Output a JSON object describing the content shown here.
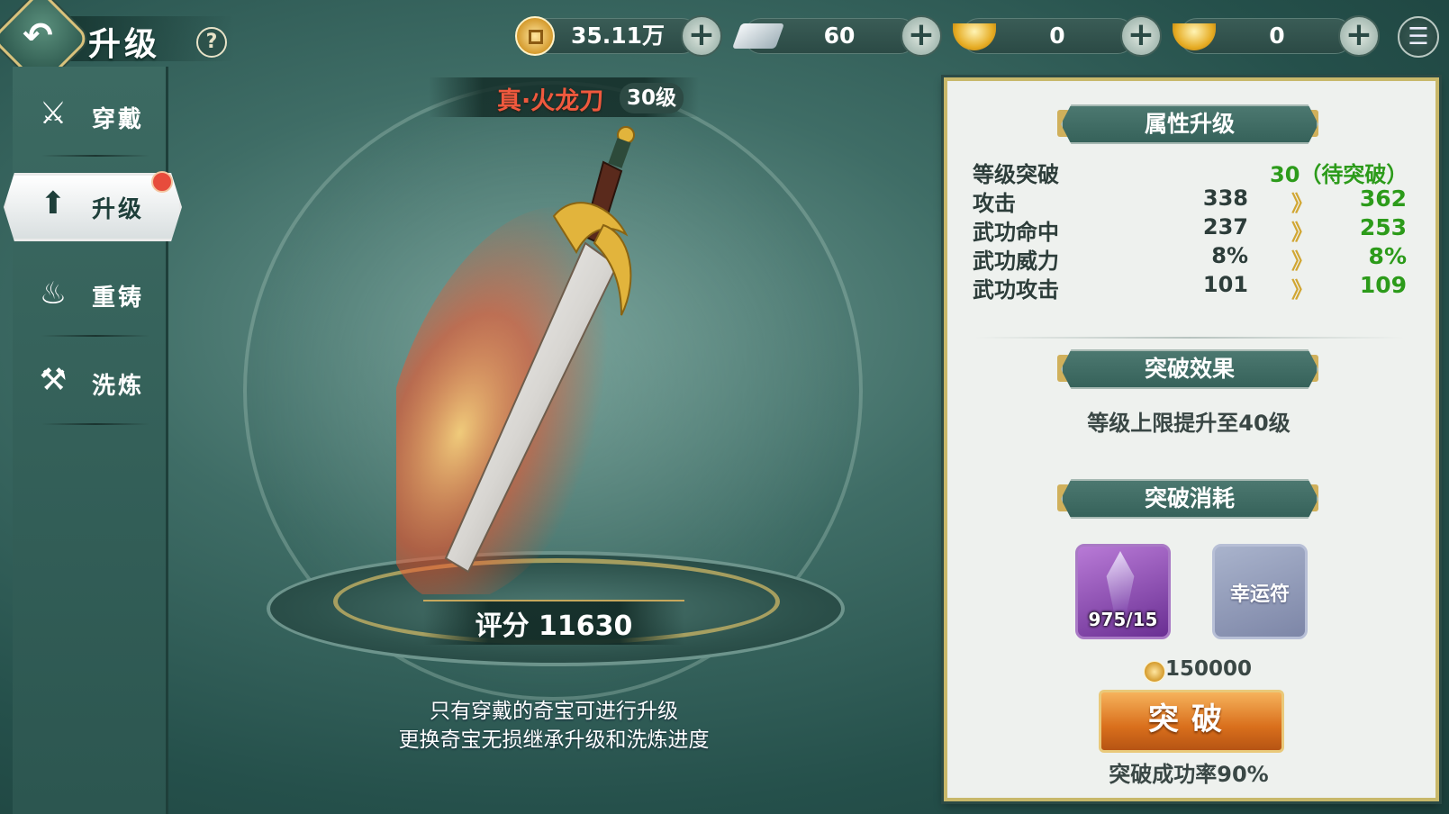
{
  "header": {
    "title": "升级",
    "help": "?"
  },
  "currencies": [
    {
      "icon": "copper-coin-icon",
      "value": "35.11万"
    },
    {
      "icon": "silver-ingot-icon",
      "value": "60"
    },
    {
      "icon": "locked-gold-ingot-icon",
      "value": "0"
    },
    {
      "icon": "gold-ingot-icon",
      "value": "0"
    }
  ],
  "sidebar": {
    "items": [
      {
        "label": "穿戴",
        "icon": "crossed-swords-icon"
      },
      {
        "label": "升级",
        "icon": "upgrade-arrow-icon",
        "active": true,
        "badge": "red-dot"
      },
      {
        "label": "重铸",
        "icon": "flame-icon"
      },
      {
        "label": "洗炼",
        "icon": "anvil-icon"
      }
    ]
  },
  "weapon": {
    "name": "真·火龙刀",
    "level": "30级",
    "score": "评分 11630"
  },
  "hints": [
    "只有穿戴的奇宝可进行升级",
    "更换奇宝无损继承升级和洗炼进度"
  ],
  "panel": {
    "attr_title": "属性升级",
    "level_row": {
      "label": "等级突破",
      "value": "30（待突破）"
    },
    "stats": [
      {
        "label": "攻击",
        "old": "338",
        "new": "362"
      },
      {
        "label": "武功命中",
        "old": "237",
        "new": "253"
      },
      {
        "label": "武功威力",
        "old": "8%",
        "new": "8%"
      },
      {
        "label": "武功攻击",
        "old": "101",
        "new": "109"
      }
    ],
    "arrow": "》",
    "effect_title": "突破效果",
    "effect_text": "等级上限提升至40级",
    "cost_title": "突破消耗",
    "items": [
      {
        "icon": "purple-crystal-icon",
        "count": "975/15"
      },
      {
        "label": "幸运符"
      }
    ],
    "coin_cost": "150000",
    "button": "突破",
    "success_rate": "突破成功率90%"
  },
  "colors": {
    "accent_green": "#2c9b1a",
    "weapon_name": "#f0593e",
    "button_orange": "#d96f1c",
    "panel_border": "#c8b86a"
  }
}
